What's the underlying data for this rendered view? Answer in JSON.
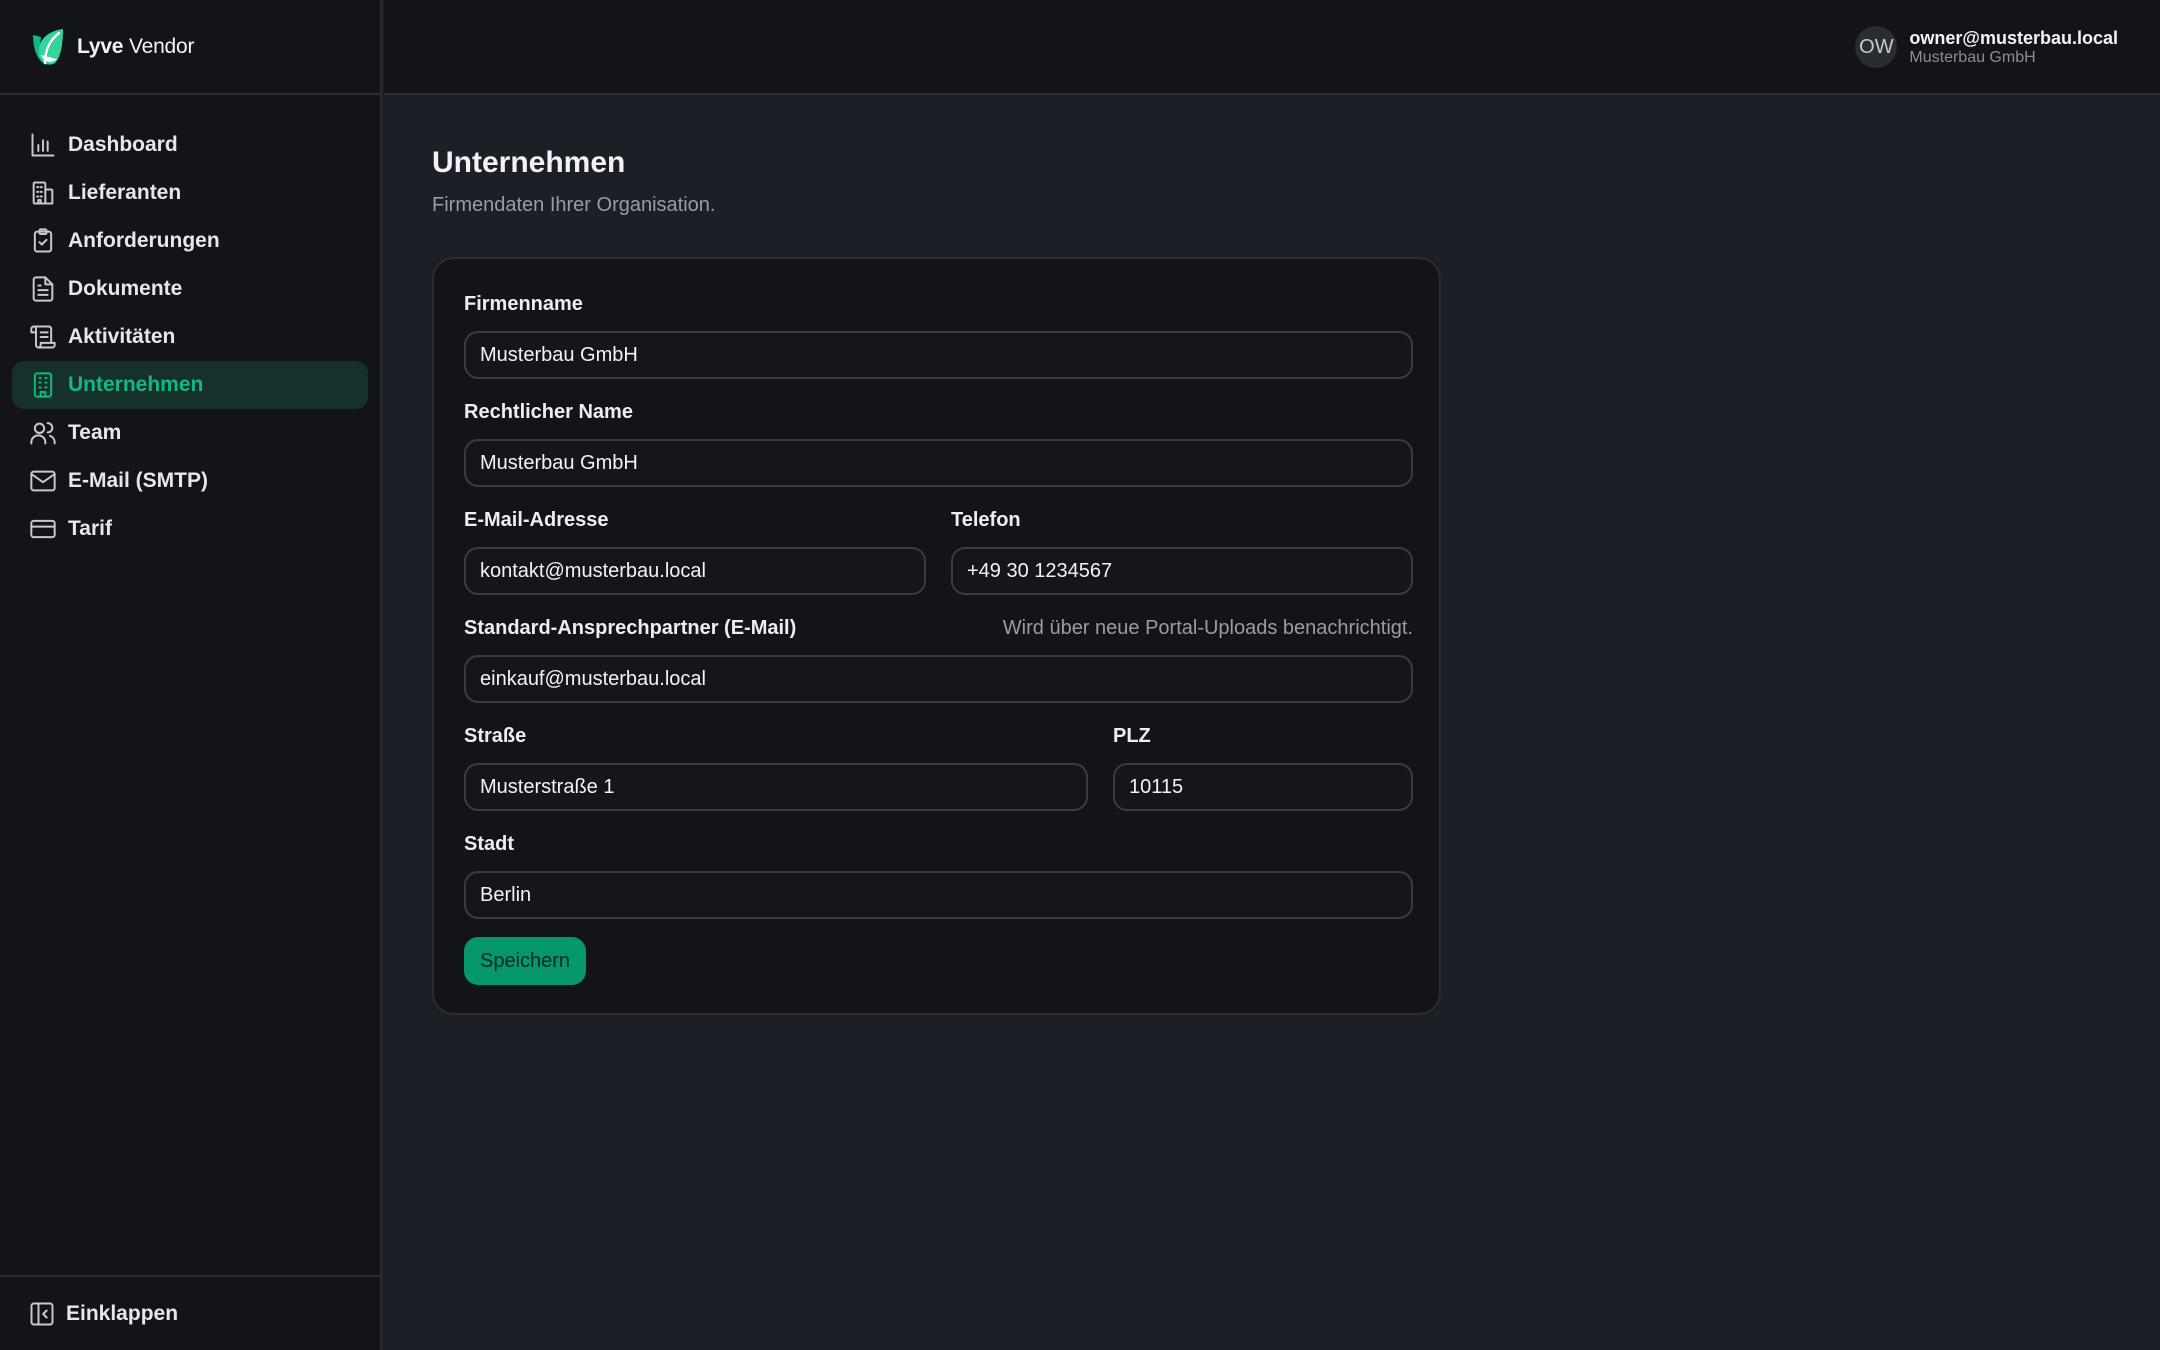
{
  "brand": {
    "name_bold": "Lyve",
    "name_light": "Vendor"
  },
  "sidebar": {
    "items": [
      {
        "label": "Dashboard",
        "icon": "bar-chart-icon"
      },
      {
        "label": "Lieferanten",
        "icon": "building-icon"
      },
      {
        "label": "Anforderungen",
        "icon": "clipboard-check-icon"
      },
      {
        "label": "Dokumente",
        "icon": "file-text-icon"
      },
      {
        "label": "Aktivitäten",
        "icon": "scroll-icon"
      },
      {
        "label": "Unternehmen",
        "icon": "office-building-icon",
        "active": true
      },
      {
        "label": "Team",
        "icon": "users-icon"
      },
      {
        "label": "E-Mail (SMTP)",
        "icon": "mail-icon"
      },
      {
        "label": "Tarif",
        "icon": "credit-card-icon"
      }
    ],
    "collapse_label": "Einklappen"
  },
  "user": {
    "initials": "OW",
    "email": "owner@musterbau.local",
    "org": "Musterbau GmbH"
  },
  "page": {
    "title": "Unternehmen",
    "subtitle": "Firmendaten Ihrer Organisation."
  },
  "form": {
    "company_name": {
      "label": "Firmenname",
      "value": "Musterbau GmbH"
    },
    "legal_name": {
      "label": "Rechtlicher Name",
      "value": "Musterbau GmbH"
    },
    "email": {
      "label": "E-Mail-Adresse",
      "value": "kontakt@musterbau.local"
    },
    "phone": {
      "label": "Telefon",
      "value": "+49 30 1234567"
    },
    "default_contact": {
      "label": "Standard-Ansprechpartner (E-Mail)",
      "hint": "Wird über neue Portal-Uploads benachrichtigt.",
      "value": "einkauf@musterbau.local"
    },
    "street": {
      "label": "Straße",
      "value": "Musterstraße 1"
    },
    "zip": {
      "label": "PLZ",
      "value": "10115"
    },
    "city": {
      "label": "Stadt",
      "value": "Berlin"
    },
    "save_label": "Speichern"
  },
  "colors": {
    "accent": "#10b981",
    "button": "#059669",
    "background": "#1d1f26",
    "surface": "#131419"
  }
}
